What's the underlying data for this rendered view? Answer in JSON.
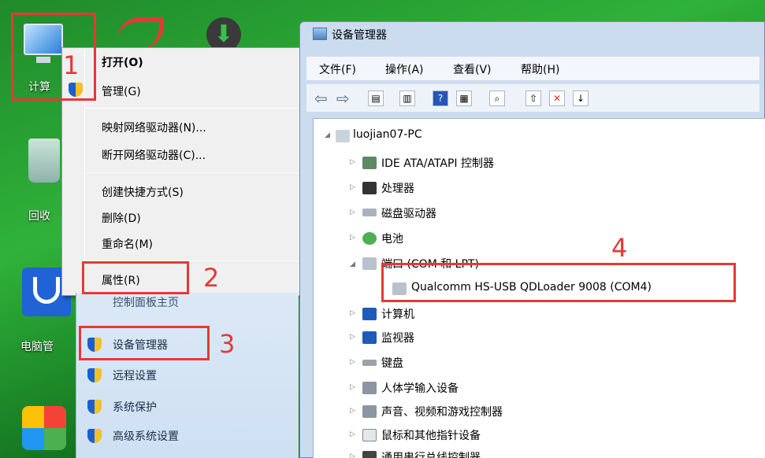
{
  "desktop": {
    "icons": [
      {
        "label": "计算"
      },
      {
        "label": "回收"
      },
      {
        "label": "电脑管"
      }
    ]
  },
  "context_menu": {
    "items": [
      {
        "label": "打开(O)",
        "bold": true
      },
      {
        "label": "管理(G)"
      },
      {
        "label": "映射网络驱动器(N)..."
      },
      {
        "label": "断开网络驱动器(C)..."
      },
      {
        "label": "创建快捷方式(S)"
      },
      {
        "label": "删除(D)"
      },
      {
        "label": "重命名(M)"
      },
      {
        "label": "属性(R)"
      }
    ]
  },
  "control_panel": {
    "partial_item": "控制面板主页",
    "items": [
      {
        "label": "设备管理器"
      },
      {
        "label": "远程设置"
      },
      {
        "label": "系统保护"
      },
      {
        "label": "高级系统设置"
      }
    ]
  },
  "device_manager": {
    "title": "设备管理器",
    "menus": [
      "文件(F)",
      "操作(A)",
      "查看(V)",
      "帮助(H)"
    ],
    "root": "luojian07-PC",
    "nodes": [
      {
        "label": "IDE ATA/ATAPI 控制器"
      },
      {
        "label": "处理器"
      },
      {
        "label": "磁盘驱动器"
      },
      {
        "label": "电池"
      },
      {
        "label": "端口 (COM 和 LPT)"
      },
      {
        "label": "Qualcomm HS-USB QDLoader 9008 (COM4)"
      },
      {
        "label": "计算机"
      },
      {
        "label": "监视器"
      },
      {
        "label": "键盘"
      },
      {
        "label": "人体学输入设备"
      },
      {
        "label": "声音、视频和游戏控制器"
      },
      {
        "label": "鼠标和其他指针设备"
      },
      {
        "label": "通用串行总线控制器"
      }
    ]
  },
  "annotations": [
    "1",
    "2",
    "3",
    "4"
  ],
  "colors": {
    "annotation": "#e53935",
    "desktop": "#2fb23a"
  }
}
